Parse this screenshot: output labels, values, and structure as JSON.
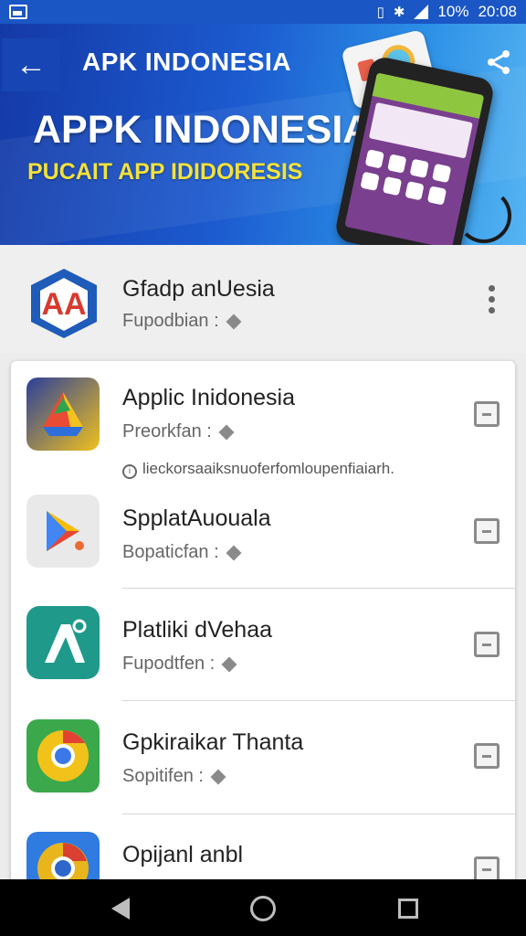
{
  "status_bar": {
    "battery": "10%",
    "time": "20:08"
  },
  "toolbar": {
    "title": "APK INDONESIA"
  },
  "banner": {
    "headline": "APPK INDONESIA",
    "subheadline": "PUCAIT APP IDIDORESIS"
  },
  "featured": {
    "name": "Gfadp anUesia",
    "subtitle": "Fupodbian :"
  },
  "apps": [
    {
      "name": "Applic Inidonesia",
      "subtitle": "Preorkfan :",
      "note": "lieckorsaaiksnuoferfomloupenfiaiarh."
    },
    {
      "name": "SpplatAuouala",
      "subtitle": "Bopaticfan :"
    },
    {
      "name": "Platliki dVehaa",
      "subtitle": "Fupodtfen :"
    },
    {
      "name": "Gpkiraikar Thanta",
      "subtitle": "Sopitifen :"
    },
    {
      "name": "Opijanl anbl",
      "subtitle": ""
    }
  ],
  "colors": {
    "toolbar": "#1a56c4",
    "accent_yellow": "#f3e23a",
    "card": "#ffffff"
  }
}
